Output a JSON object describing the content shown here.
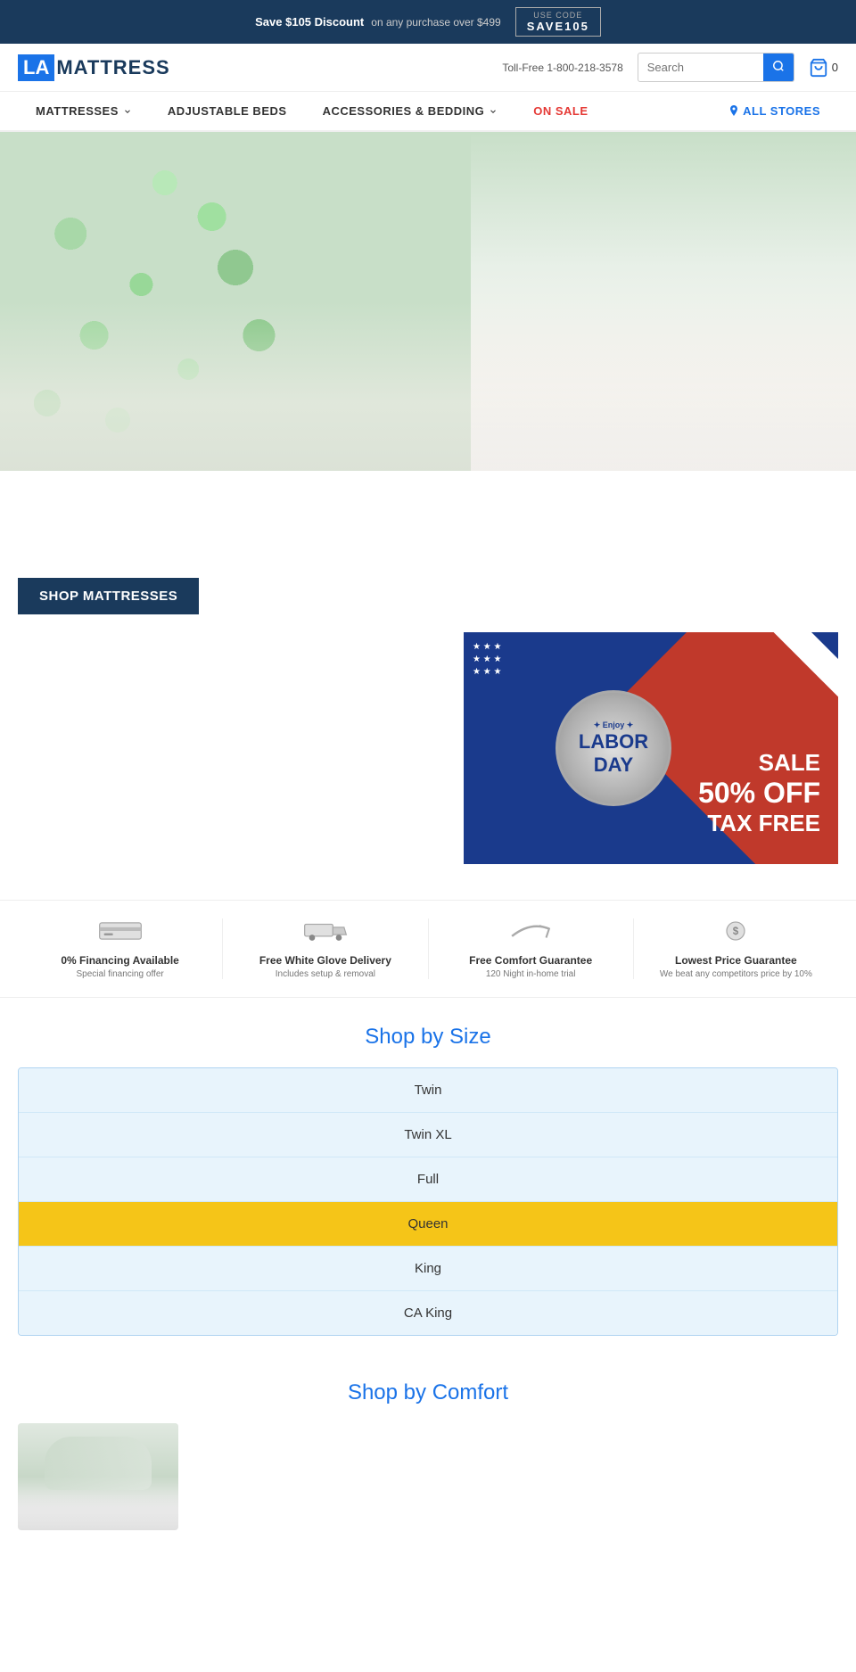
{
  "top_banner": {
    "save_text": "Save $105 Discount",
    "on_text": "on any purchase over $499",
    "use_code_label": "USE CODE",
    "promo_code": "SAVE105"
  },
  "header": {
    "logo_la": "LA",
    "logo_name": "MATTRESS",
    "toll_free": "Toll-Free 1-800-218-3578",
    "search_placeholder": "Search",
    "cart_count": "0"
  },
  "nav": {
    "items": [
      {
        "label": "MATTRESSES",
        "has_dropdown": true
      },
      {
        "label": "ADJUSTABLE BEDS",
        "has_dropdown": false
      },
      {
        "label": "ACCESSORIES & BEDDING",
        "has_dropdown": true
      },
      {
        "label": "ON SALE",
        "is_sale": true
      },
      {
        "label": "ALL STORES",
        "is_stores": true
      }
    ]
  },
  "labor_day": {
    "enjoy": "✦ Enjoy ✦",
    "labor": "LABOR",
    "day": "DAY",
    "sale": "SALE",
    "percent": "50% OFF",
    "tax_free": "TAX FREE"
  },
  "shop_mattresses_btn": "SHOP MATTRESSES",
  "features": [
    {
      "title": "0% Financing Available",
      "subtitle": "Special financing offer",
      "icon": "financing"
    },
    {
      "title": "Free White Glove Delivery",
      "subtitle": "Includes setup & removal",
      "icon": "delivery"
    },
    {
      "title": "Free Comfort Guarantee",
      "subtitle": "120 Night in-home trial",
      "icon": "comfort"
    },
    {
      "title": "Lowest Price Guarantee",
      "subtitle": "We beat any competitors price by 10%",
      "icon": "price"
    }
  ],
  "shop_by_size": {
    "title": "Shop by Size",
    "sizes": [
      {
        "label": "Twin",
        "active": false
      },
      {
        "label": "Twin XL",
        "active": false
      },
      {
        "label": "Full",
        "active": false
      },
      {
        "label": "Queen",
        "active": true
      },
      {
        "label": "King",
        "active": false
      },
      {
        "label": "CA King",
        "active": false
      }
    ]
  },
  "shop_by_comfort": {
    "title": "Shop by Comfort"
  }
}
